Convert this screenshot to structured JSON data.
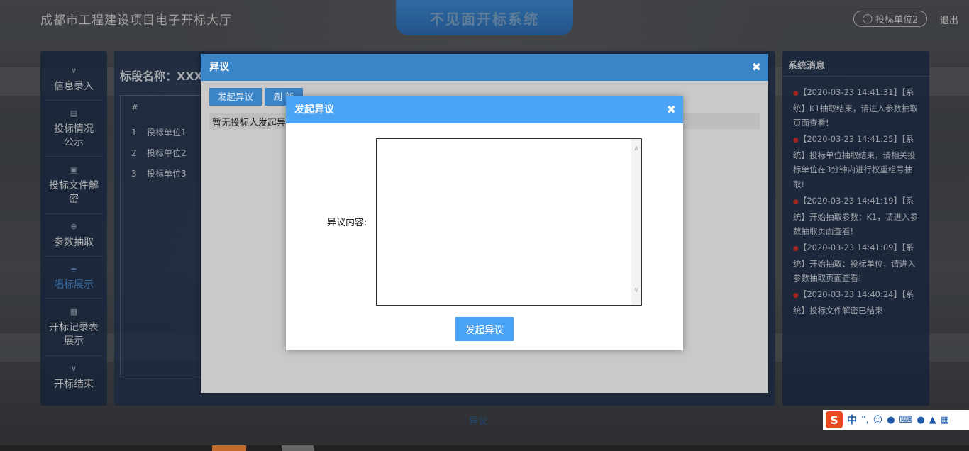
{
  "header": {
    "site_title": "成都市工程建设项目电子开标大厅",
    "system_name": "不见面开标系统",
    "user_label": "投标单位2",
    "logout_label": "退出"
  },
  "nav": {
    "items": [
      {
        "label": "信息录入"
      },
      {
        "label": "投标情况公示"
      },
      {
        "label": "投标文件解密"
      },
      {
        "label": "参数抽取"
      },
      {
        "label": "唱标展示"
      },
      {
        "label": "开标记录表展示"
      },
      {
        "label": "开标结束"
      }
    ],
    "active_index": 4
  },
  "main": {
    "section_title": "标段名称：XXX",
    "list_header": "#",
    "rows": [
      {
        "idx": "1",
        "name": "投标单位1"
      },
      {
        "idx": "2",
        "name": "投标单位2"
      },
      {
        "idx": "3",
        "name": "投标单位3"
      }
    ]
  },
  "messages": {
    "title": "系统消息",
    "items": [
      {
        "text": "【2020-03-23 14:41:31】【系统】K1抽取结束，请进入参数抽取页面查看!"
      },
      {
        "text": "【2020-03-23 14:41:25】【系统】投标单位抽取结束，请相关投标单位在3分钟内进行权重组号抽取!"
      },
      {
        "text": "【2020-03-23 14:41:19】【系统】开始抽取参数：K1，请进入参数抽取页面查看!"
      },
      {
        "text": "【2020-03-23 14:41:09】【系统】开始抽取：投标单位，请进入参数抽取页面查看!"
      },
      {
        "text": "【2020-03-23 14:40:24】【系统】投标文件解密已结束"
      }
    ]
  },
  "dialog_objection": {
    "title": "异议",
    "btn_start": "发起异议",
    "btn_refresh": "刷 新",
    "empty_text": "暂无投标人发起异"
  },
  "dialog_start": {
    "title": "发起异议",
    "content_label": "异议内容:",
    "content_value": "",
    "submit_label": "发起异议"
  },
  "bottom": {
    "label": "异议"
  },
  "ime": {
    "logo": "S",
    "mode": "中"
  },
  "colors": {
    "primary_blue": "#3a84c8",
    "dialog_blue": "#4aa3f5",
    "alert_red": "#d9322e"
  }
}
